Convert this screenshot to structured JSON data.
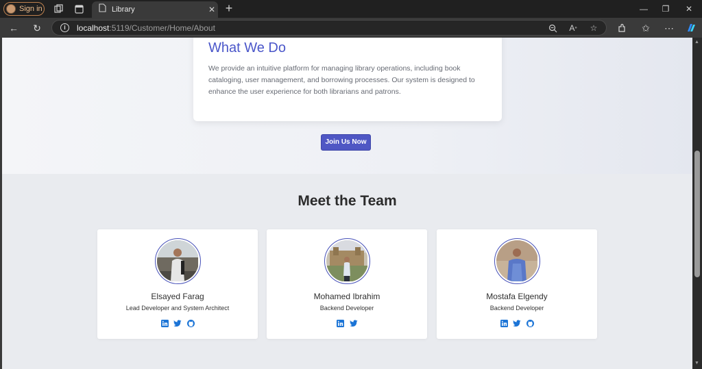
{
  "browser": {
    "profile_label": "Sign in",
    "tab_title": "Library",
    "url_host": "localhost",
    "url_path": ":5119/Customer/Home/About"
  },
  "about": {
    "what_title": "What We Do",
    "what_text": "We provide an intuitive platform for managing library operations, including book cataloging, user management, and borrowing processes. Our system is designed to enhance the user experience for both librarians and patrons.",
    "join_label": "Join Us Now"
  },
  "team": {
    "title": "Meet the Team",
    "members": [
      {
        "name": "Elsayed Farag",
        "role": "Lead Developer and System Architect",
        "socials": [
          "linkedin-icon",
          "twitter-icon",
          "github-icon"
        ]
      },
      {
        "name": "Mohamed Ibrahim",
        "role": "Backend Developer",
        "socials": [
          "linkedin-icon",
          "twitter-icon"
        ]
      },
      {
        "name": "Mostafa Elgendy",
        "role": "Backend Developer",
        "socials": [
          "linkedin-icon",
          "twitter-icon",
          "github-icon"
        ]
      }
    ]
  },
  "colors": {
    "accent": "#4f57c4",
    "heading_accent": "#4a56c9",
    "social_blue": "#1b74d6"
  }
}
